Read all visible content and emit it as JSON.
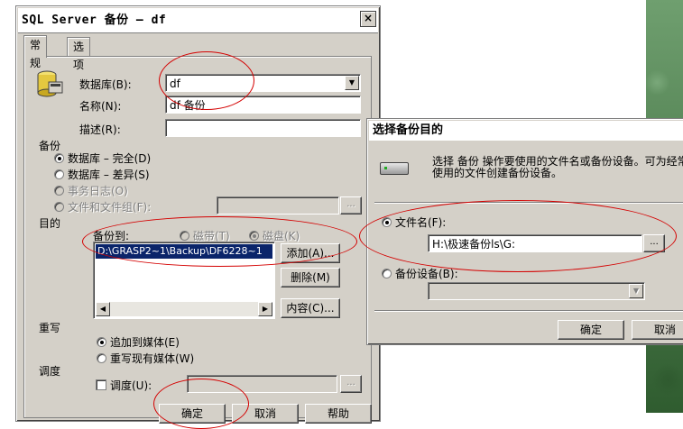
{
  "dialog1": {
    "title": "SQL Server 备份 — df",
    "close_label": "×",
    "tabs": [
      "常规",
      "选项"
    ],
    "database_label": "数据库(B):",
    "database_value": "df",
    "name_label": "名称(N):",
    "name_value": "df 备份",
    "description_label": "描述(R):",
    "description_value": "",
    "backup_group_label": "备份",
    "backup_options": [
      {
        "label": "数据库 – 完全(D)",
        "checked": true,
        "enabled": true
      },
      {
        "label": "数据库 – 差异(S)",
        "checked": false,
        "enabled": true
      },
      {
        "label": "事务日志(O)",
        "checked": false,
        "enabled": false
      },
      {
        "label": "文件和文件组(F):",
        "checked": false,
        "enabled": false
      }
    ],
    "ellipsis_label": "...",
    "destination_label": "目的",
    "backup_to_label": "备份到:",
    "tape_label": "磁带(T)",
    "disk_label": "磁盘(K)",
    "destination_items": [
      "D:\\GRASP2~1\\Backup\\DF6228~1"
    ],
    "add_button": "添加(A)...",
    "remove_button": "删除(M)",
    "contents_button": "内容(C)...",
    "overwrite_label": "重写",
    "overwrite_options": [
      {
        "label": "追加到媒体(E)",
        "checked": true
      },
      {
        "label": "重写现有媒体(W)",
        "checked": false
      }
    ],
    "schedule_label": "调度",
    "schedule_checkbox_label": "调度(U):",
    "ok_button": "确定",
    "cancel_button": "取消",
    "help_button": "帮助"
  },
  "dialog2": {
    "title": "选择备份目的",
    "description_line1": "选择 备份 操作要使用的文件名或备份设备。可为经常",
    "description_line2": "使用的文件创建备份设备。",
    "filename_radio": "文件名(F):",
    "filename_value": "H:\\极速备份ls\\G:",
    "device_radio": "备份设备(B):",
    "device_value": "",
    "ellipsis_label": "...",
    "ok_button": "确定",
    "cancel_button": "取消"
  },
  "colors": {
    "dialog_face": "#d4d0c8",
    "selection": "#0a246a",
    "annotation_red": "#d40000"
  }
}
